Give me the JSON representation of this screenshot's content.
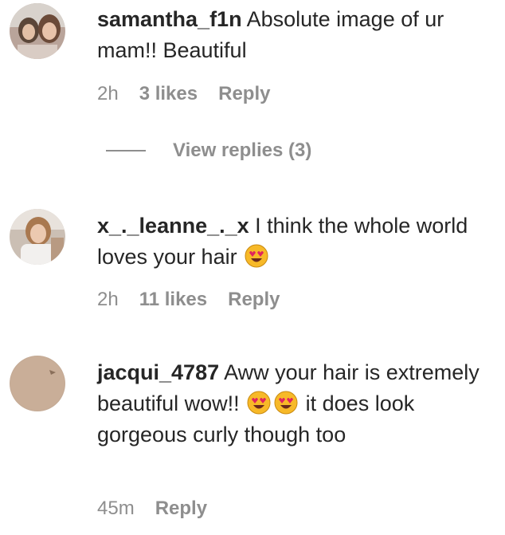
{
  "comments": [
    {
      "username": "samantha_f1n",
      "text": "Absolute image of ur mam!! Beautiful",
      "time": "2h",
      "likes": "3 likes",
      "reply": "Reply",
      "view_replies": "View replies (3)"
    },
    {
      "username": "x_._leanne_._x",
      "text_before": "I think the whole world loves your hair",
      "emojis": [
        "heart-eyes-emoji"
      ],
      "time": "2h",
      "likes": "11 likes",
      "reply": "Reply"
    },
    {
      "username": "jacqui_4787",
      "text_before": "Aww your hair is extremely beautiful wow!!",
      "emojis": [
        "heart-eyes-emoji",
        "heart-eyes-emoji"
      ],
      "text_after": "it does look gorgeous curly though too",
      "time": "45m",
      "reply": "Reply"
    }
  ],
  "colors": {
    "text": "#262626",
    "secondary": "#8e8e8e",
    "background": "#ffffff",
    "emoji_face": "#f7b928",
    "emoji_heart": "#e0245e"
  }
}
